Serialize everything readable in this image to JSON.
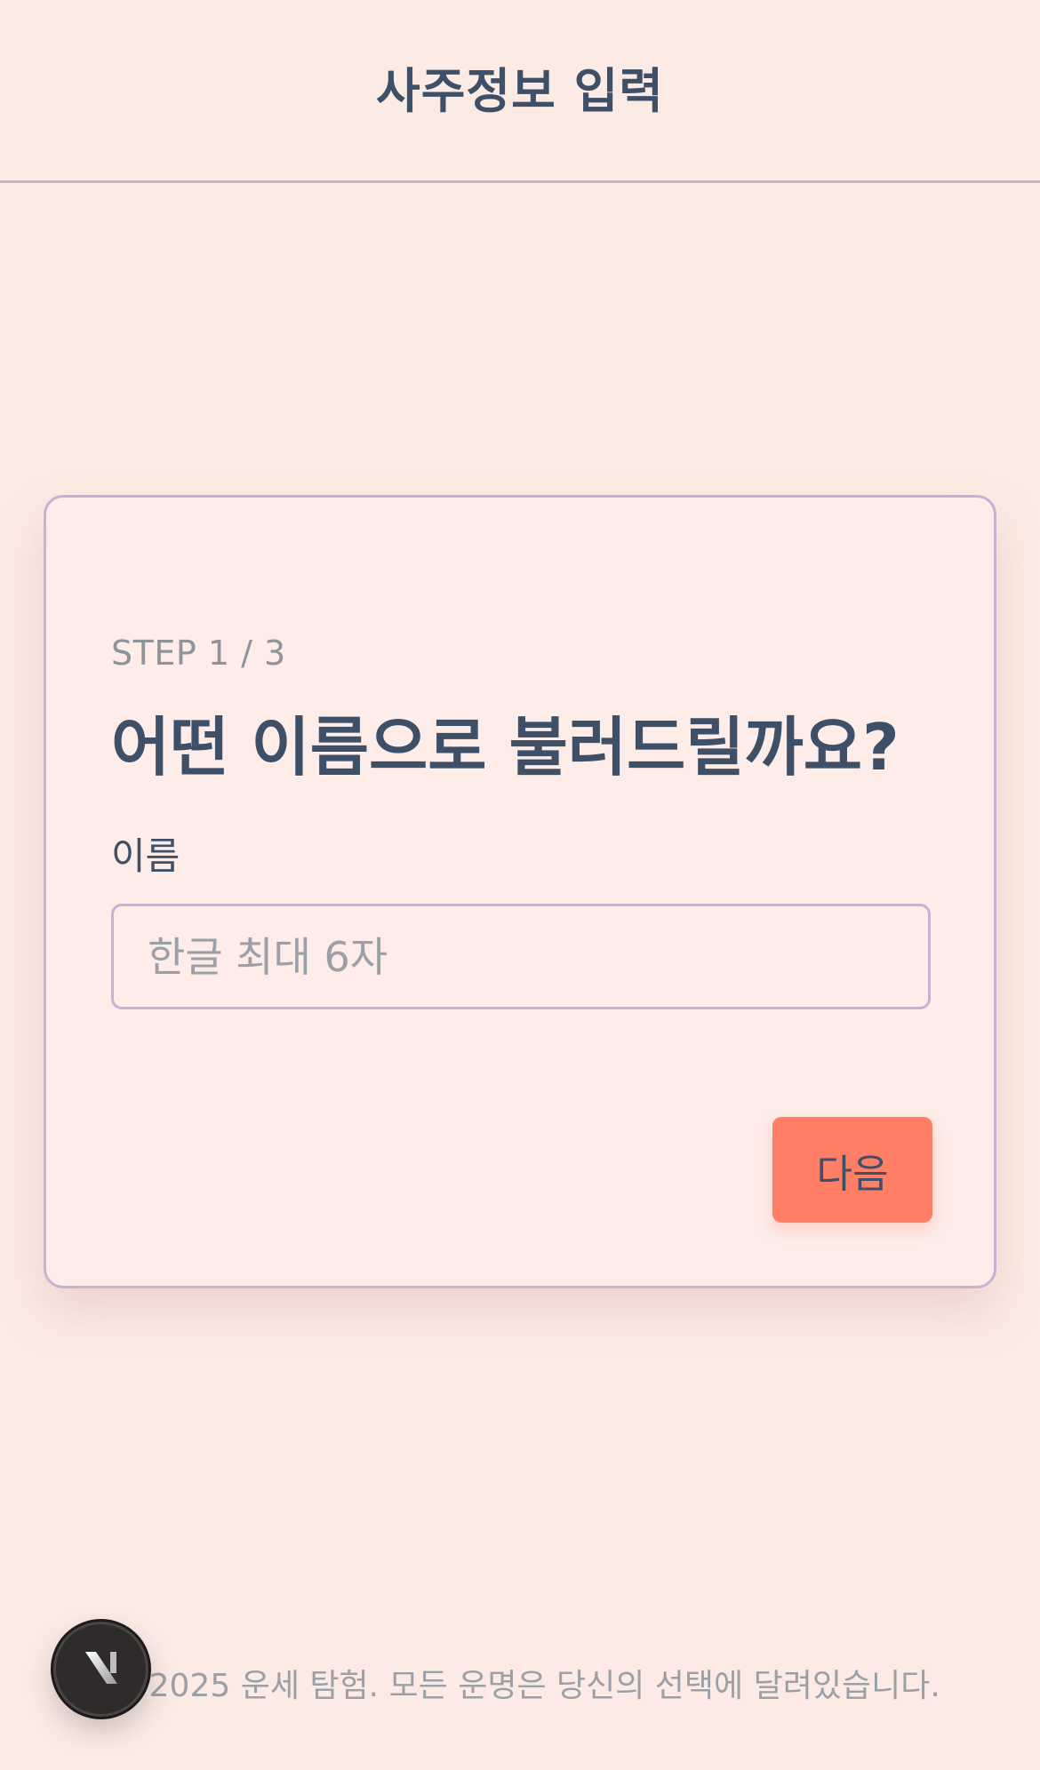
{
  "header": {
    "title": "사주정보 입력"
  },
  "form": {
    "step": "STEP 1 / 3",
    "question": "어떤 이름으로 불러드릴까요?",
    "name_label": "이름",
    "name_placeholder": "한글 최대 6자",
    "name_value": "",
    "next_label": "다음"
  },
  "footer": {
    "text": "© 2025 운세 탐험. 모든 운명은 당신의 선택에 달려있습니다."
  },
  "badge": {
    "icon": "logo-n-icon"
  },
  "colors": {
    "background": "#fcebe5",
    "primary_text": "#3d5068",
    "muted_text": "#9aa0a6",
    "border": "#c3b4d6",
    "accent": "#ff7f66"
  }
}
